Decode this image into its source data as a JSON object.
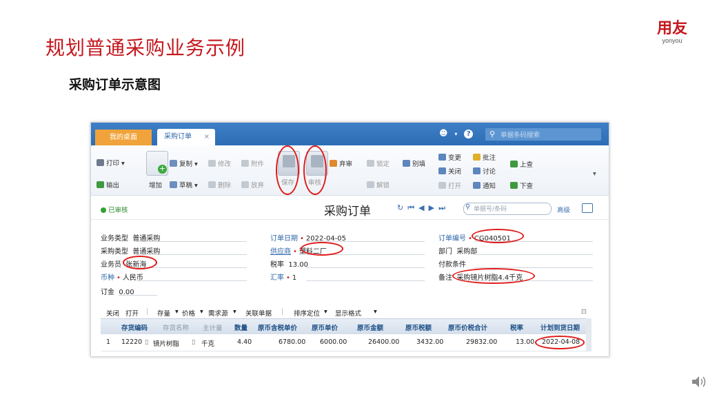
{
  "slide": {
    "title": "规划普通采购业务示例",
    "subtitle": "采购订单示意图",
    "logo_main": "用友",
    "logo_sub": "yonyou"
  },
  "app": {
    "tabs": [
      {
        "label": "我的桌面"
      },
      {
        "label": "采购订单"
      }
    ],
    "tab_close": "×",
    "search_placeholder": "单据条码搜索",
    "toolbar": {
      "print": "打印",
      "export": "输出",
      "add": "增加",
      "copy": "复制",
      "draft": "草稿",
      "modify": "修改",
      "attachment": "附件",
      "delete": "删除",
      "abandon": "放弃",
      "save": "保存",
      "audit": "审核",
      "unaudit": "弃审",
      "lock": "锁定",
      "unlock": "解锁",
      "other": "别填",
      "change": "变更",
      "close": "关闭",
      "open": "打开",
      "annotate": "批注",
      "discuss": "讨论",
      "notify": "通知",
      "prev": "上查",
      "next": "下查"
    },
    "form": {
      "status": "已审核",
      "title": "采购订单",
      "nav_placeholder": "单据号/条码",
      "advanced": "高级",
      "fields": {
        "biz_type_label": "业务类型",
        "biz_type": "普通采购",
        "purchase_type_label": "采购类型",
        "purchase_type": "普通采购",
        "salesman_label": "业务员",
        "salesman": "张新海",
        "currency_label": "币种",
        "currency": "人民币",
        "deposit_label": "订金",
        "deposit": "0.00",
        "order_date_label": "订单日期",
        "order_date": "2022-04-05",
        "supplier_label": "供应商",
        "supplier": "塑料二厂",
        "tax_rate_label": "税率",
        "tax_rate": "13.00",
        "exchange_label": "汇率",
        "exchange": "1",
        "order_no_label": "订单编号",
        "order_no": "CG040501",
        "dept_label": "部门",
        "dept": "采购部",
        "payment_label": "付款条件",
        "payment": "",
        "remark_label": "备注",
        "remark": "采购镜片树脂4.4千克"
      }
    },
    "grid_toolbar": [
      "关闭",
      "打开",
      "存量",
      "价格",
      "需求源",
      "关联单据",
      "排序定位",
      "显示格式"
    ],
    "grid_columns": [
      "存货编码",
      "存货名称",
      "主计量",
      "数量",
      "原币含税单价",
      "原币单价",
      "原币金额",
      "原币税额",
      "原币价税合计",
      "税率",
      "计划到货日期"
    ],
    "grid_rows": [
      {
        "no": "1",
        "code": "12220",
        "name": "镜片树脂",
        "unit": "千克",
        "qty": "4.40",
        "tax_price": "6780.00",
        "price": "6000.00",
        "amount": "26400.00",
        "tax": "3432.00",
        "total": "29832.00",
        "rate": "13.00",
        "plan_date": "2022-04-08"
      }
    ]
  },
  "colors": {
    "title_red": "#c4161c",
    "tab_bar_blue": "#2c6db5",
    "home_tab_orange": "#f0a33a",
    "highlight_ring": "#e01a1a"
  }
}
